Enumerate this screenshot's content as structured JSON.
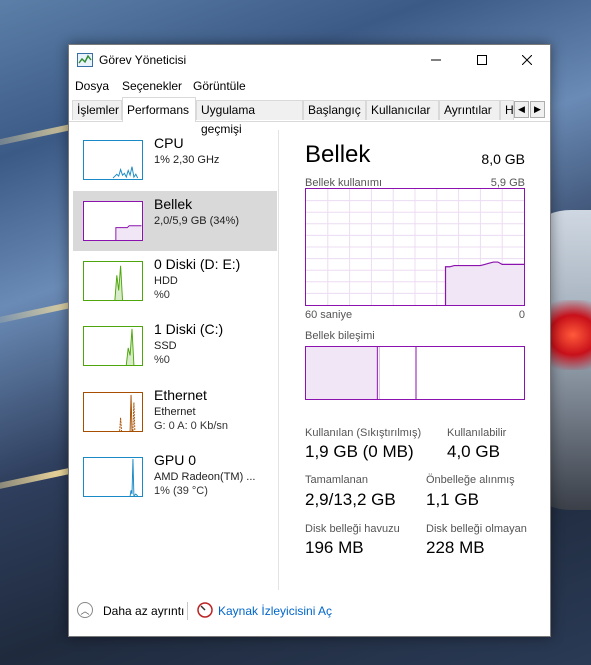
{
  "window": {
    "title": "Görev Yöneticisi"
  },
  "menu": [
    "Dosya",
    "Seçenekler",
    "Görüntüle"
  ],
  "tabs": [
    {
      "label": "İşlemler",
      "active": false
    },
    {
      "label": "Performans",
      "active": true
    },
    {
      "label": "Uygulama geçmişi",
      "active": false
    },
    {
      "label": "Başlangıç",
      "active": false
    },
    {
      "label": "Kullanıcılar",
      "active": false
    },
    {
      "label": "Ayrıntılar",
      "active": false
    },
    {
      "label": "H",
      "active": false
    }
  ],
  "sidebar": [
    {
      "name": "CPU",
      "line1": "1% 2,30 GHz",
      "line2": "",
      "color": "#1a8ac6",
      "selected": false
    },
    {
      "name": "Bellek",
      "line1": "2,0/5,9 GB (34%)",
      "line2": "",
      "color": "#8b12ae",
      "selected": true
    },
    {
      "name": "0 Diski (D: E:)",
      "line1": "HDD",
      "line2": "%0",
      "color": "#4da60c",
      "selected": false
    },
    {
      "name": "1 Diski (C:)",
      "line1": "SSD",
      "line2": "%0",
      "color": "#4da60c",
      "selected": false
    },
    {
      "name": "Ethernet",
      "line1": "Ethernet",
      "line2": "G: 0 A: 0 Kb/sn",
      "color": "#a74f01",
      "selected": false
    },
    {
      "name": "GPU 0",
      "line1": "AMD Radeon(TM) ...",
      "line2": "1% (39 °C)",
      "color": "#1a8ac6",
      "selected": false
    }
  ],
  "main": {
    "title": "Bellek",
    "total": "8,0 GB",
    "usage_label": "Bellek kullanımı",
    "usage_max": "5,9 GB",
    "axis_left": "60 saniye",
    "axis_right": "0",
    "composition_label": "Bellek bileşimi",
    "usage_fraction_history": [
      0,
      0,
      0,
      0,
      0,
      0,
      0,
      0,
      0,
      0,
      0,
      0,
      0,
      0,
      0,
      0,
      0,
      0,
      0,
      0,
      0,
      0,
      0,
      0,
      0,
      0,
      0,
      0,
      0,
      0,
      0,
      0,
      0.33,
      0.33,
      0.34,
      0.34,
      0.34,
      0.34,
      0.34,
      0.34,
      0.34,
      0.35,
      0.36,
      0.37,
      0.37,
      0.35,
      0.35,
      0.35,
      0.35,
      0.35,
      0.35
    ],
    "stats": [
      {
        "label": "Kullanılan (Sıkıştırılmış)",
        "value": "1,9 GB (0 MB)"
      },
      {
        "label": "Kullanılabilir",
        "value": "4,0 GB"
      },
      {
        "label": "Tamamlanan",
        "value": "2,9/13,2 GB"
      },
      {
        "label": "Önbelleğe alınmış",
        "value": "1,1 GB"
      },
      {
        "label": "Disk belleği havuzu",
        "value": "196 MB"
      },
      {
        "label": "Disk belleği olmayan",
        "value": "228 MB"
      }
    ]
  },
  "footer": {
    "fewer_details": "Daha az ayrıntı",
    "resource_monitor": "Kaynak İzleyicisini Aç"
  }
}
